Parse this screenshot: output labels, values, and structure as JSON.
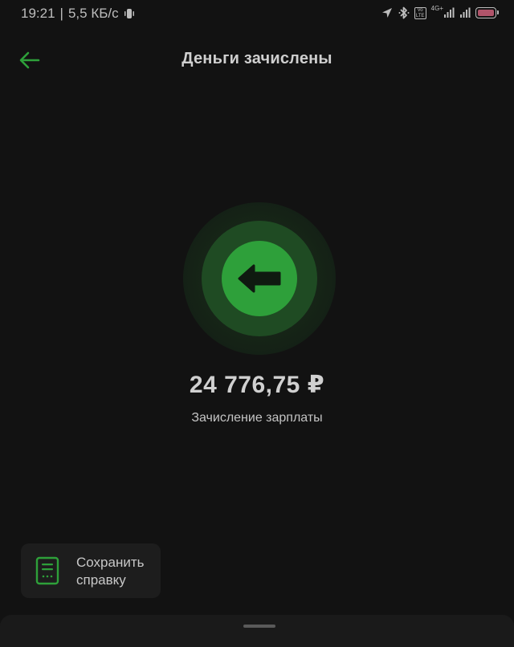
{
  "status_bar": {
    "time": "19:21",
    "separator": "|",
    "speed": "5,5 КБ/с",
    "volte_label": "Vo LTE",
    "network_type": "4G+",
    "icons": [
      "vibrate-icon",
      "location-icon",
      "bluetooth-icon",
      "volte-icon",
      "signal-icon",
      "signal-icon",
      "battery-icon"
    ],
    "battery_color": "#b0546a"
  },
  "header": {
    "title": "Деньги зачислены",
    "back_icon": "arrow-left-icon",
    "accent_color": "#2ea03a"
  },
  "operation": {
    "icon": "arrow-left-icon",
    "amount": "24 776,75 ₽",
    "description": "Зачисление зарплаты",
    "circle_color": "#2ea03a"
  },
  "actions": {
    "save_certificate": {
      "icon": "document-icon",
      "label": "Сохранить справку"
    }
  }
}
